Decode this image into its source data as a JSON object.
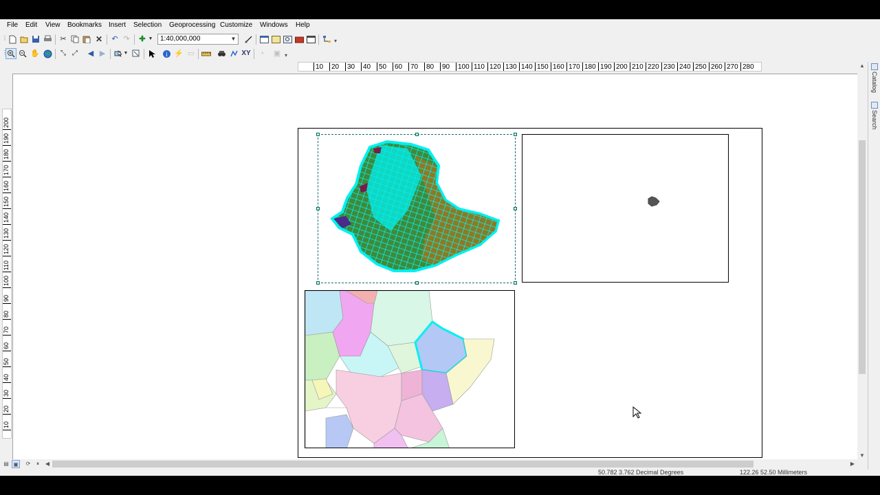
{
  "menu": [
    "File",
    "Edit",
    "View",
    "Bookmarks",
    "Insert",
    "Selection",
    "Geoprocessing",
    "Customize",
    "Windows",
    "Help"
  ],
  "toolbar": {
    "scale": "1:40,000,000",
    "icons_row1": [
      "new-document-icon",
      "open-icon",
      "save-icon",
      "print-icon",
      "cut-icon",
      "copy-icon",
      "paste-icon",
      "delete-icon",
      "undo-icon",
      "redo-icon",
      "add-data-icon"
    ],
    "icons_row1_right": [
      "editor-toolbar-icon",
      "table-of-contents-icon",
      "catalog-window-icon",
      "search-window-icon",
      "arctoolbox-icon",
      "python-window-icon",
      "modelbuilder-icon"
    ],
    "icons_row2": [
      "zoom-in-icon",
      "zoom-out-icon",
      "pan-icon",
      "full-extent-icon",
      "fixed-zoom-in-icon",
      "fixed-zoom-out-icon",
      "go-back-icon",
      "go-forward-icon",
      "select-features-icon",
      "clear-selection-icon",
      "select-elements-icon",
      "identify-icon",
      "hyperlink-icon",
      "html-popup-icon",
      "measure-icon",
      "find-icon",
      "find-route-icon",
      "go-to-xy-icon",
      "time-slider-icon",
      "create-viewer-window-icon"
    ]
  },
  "hruler": [
    "10",
    "20",
    "30",
    "40",
    "50",
    "60",
    "70",
    "80",
    "90",
    "100",
    "110",
    "120",
    "130",
    "140",
    "150",
    "160",
    "170",
    "180",
    "190",
    "200",
    "210",
    "220",
    "230",
    "240",
    "250",
    "260",
    "270",
    "280"
  ],
  "vruler": [
    "200",
    "190",
    "180",
    "170",
    "160",
    "150",
    "140",
    "130",
    "120",
    "110",
    "100",
    "90",
    "80",
    "70",
    "60",
    "50",
    "40",
    "30",
    "20",
    "10"
  ],
  "right_panel": {
    "tab1": "Catalog",
    "tab2": "Search"
  },
  "status": {
    "coordinates": "50.782  3.762 Decimal Degrees",
    "page_position": "122.26  52.50 Millimeters"
  },
  "colors": {
    "ethiopia_fill": "#00f0f0",
    "ethiopia_olive": "#8c7a24",
    "ethiopia_green": "#3f8a3a",
    "ethiopia_purple": "#7a1c4a",
    "highlight": "#00f0f0"
  }
}
